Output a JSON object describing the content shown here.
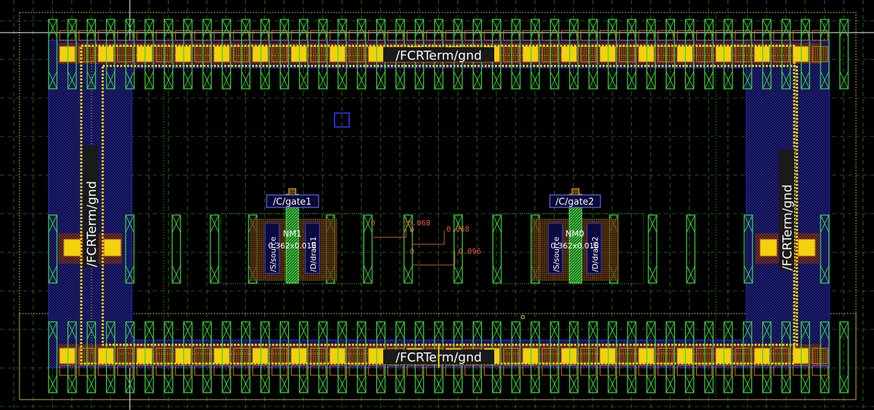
{
  "labels": {
    "net_top": "/FCRTerm/gnd",
    "net_bottom": "/FCRTerm/gnd",
    "net_left": "/FCRTerm/gnd",
    "net_right": "/FCRTerm/gnd",
    "gate1": "/C/gate1",
    "gate2": "/C/gate2",
    "nm1": "NM1",
    "nm0": "NM0",
    "source1": "/S/source",
    "source2": "/S/source",
    "drain1": "/D/drain1",
    "drain2": "/D/drain2",
    "dims1": "0.362x0.018",
    "dims2": "0.362x0.018"
  },
  "measurements": {
    "m0a": "0",
    "m0b": "0",
    "m0c": "0",
    "m068a": "0.068",
    "m068b": "0.068",
    "m096": "0.096"
  },
  "colors": {
    "background": "#000000",
    "metal_yellow": "#f2d20a",
    "poly_green": "#3cd23c",
    "nwell_blue": "#2a2ad0",
    "contact_orange": "#d87a1e",
    "grid_green": "#2e8a2e",
    "label_bg": "#1a1a1a",
    "measure_red": "#e05a3a"
  }
}
